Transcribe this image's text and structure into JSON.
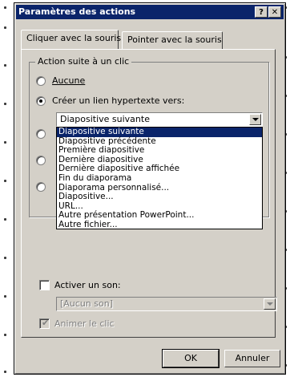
{
  "dialog": {
    "title": "Paramètres des actions",
    "help_glyph": "?",
    "close_glyph": "✕"
  },
  "tabs": [
    {
      "label": "Cliquer avec la souris",
      "active": true
    },
    {
      "label": "Pointer avec la souris",
      "active": false
    }
  ],
  "group": {
    "title": "Action suite à un clic",
    "options": {
      "none": "Aucune",
      "hyperlink": "Créer un lien hypertexte vers:"
    },
    "hyperlink_selected_value": "Diapositive suivante",
    "hyperlink_options": [
      "Diapositive suivante",
      "Diapositive précédente",
      "Première diapositive",
      "Dernière diapositive",
      "Dernière diapositive affichée",
      "Fin du diaporama",
      "Diaporama personnalisé...",
      "Diapositive...",
      "URL...",
      "Autre présentation PowerPoint...",
      "Autre fichier..."
    ]
  },
  "sound": {
    "checkbox_label": "Activer un son:",
    "select_value": "[Aucun son]"
  },
  "animate": {
    "label": "Animer le clic"
  },
  "buttons": {
    "ok": "OK",
    "cancel": "Annuler"
  }
}
